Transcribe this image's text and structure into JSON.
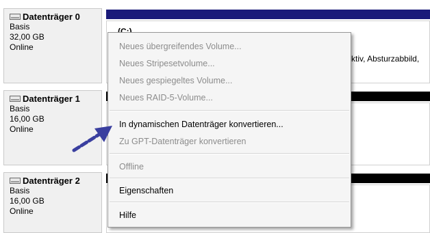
{
  "disks": [
    {
      "title": "Datenträger 0",
      "type": "Basis",
      "size": "32,00 GB",
      "status": "Online"
    },
    {
      "title": "Datenträger 1",
      "type": "Basis",
      "size": "16,00 GB",
      "status": "Online"
    },
    {
      "title": "Datenträger 2",
      "type": "Basis",
      "size": "16,00 GB",
      "status": "Online"
    }
  ],
  "volume0": {
    "name": "(C:)",
    "partial_text": "ktiv, Absturzabbild,"
  },
  "menu": {
    "items": [
      {
        "label": "Neues übergreifendes Volume...",
        "enabled": false
      },
      {
        "label": "Neues Stripesetvolume...",
        "enabled": false
      },
      {
        "label": "Neues gespiegeltes Volume...",
        "enabled": false
      },
      {
        "label": "Neues RAID-5-Volume...",
        "enabled": false
      },
      {
        "label": "In dynamischen Datenträger konvertieren...",
        "enabled": true
      },
      {
        "label": "Zu GPT-Datenträger konvertieren",
        "enabled": false
      },
      {
        "label": "Offline",
        "enabled": false
      },
      {
        "label": "Eigenschaften",
        "enabled": true
      },
      {
        "label": "Hilfe",
        "enabled": true
      }
    ]
  },
  "colors": {
    "volume_bar_primary": "#1a1a7a",
    "volume_bar_unallocated": "#000000",
    "arrow": "#3a3f9f",
    "disabled_text": "#8c8c8c"
  }
}
